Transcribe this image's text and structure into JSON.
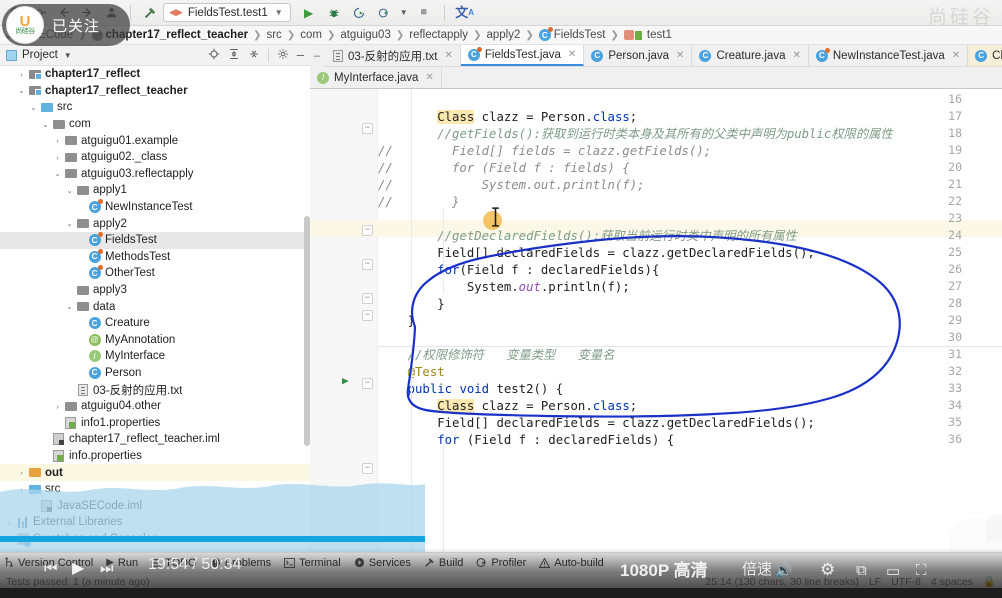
{
  "toolbar": {
    "back_icon": "arrow-left-icon",
    "forward_icon": "arrow-right-icon",
    "update_icon": "update-project-icon",
    "commit_icon": "commit-icon",
    "profile_icon": "user-icon",
    "build_icon": "hammer-icon",
    "run_config": "FieldsTest.test1",
    "run_label": "run-icon",
    "debug_label": "debug-icon",
    "coverage_label": "run-with-coverage-icon",
    "profile_label": "profiler-icon",
    "stop_label": "stop-icon",
    "translate_label": "translate-icon"
  },
  "breadcrumb": {
    "items": [
      {
        "label": "JavaSECode",
        "bold": false
      },
      {
        "label": "chapter17_reflect_teacher",
        "bold": true
      },
      {
        "label": "src",
        "bold": false
      },
      {
        "label": "com",
        "bold": false
      },
      {
        "label": "atguigu03",
        "bold": false
      },
      {
        "label": "reflectapply",
        "bold": false
      },
      {
        "label": "apply2",
        "bold": false
      },
      {
        "label": "FieldsTest",
        "bold": false
      },
      {
        "label": "test1",
        "bold": false
      }
    ]
  },
  "project_panel": {
    "title": "Project",
    "icons": [
      "locate-icon",
      "expand-all-icon",
      "collapse-all-icon",
      "settings-icon",
      "hide-icon"
    ],
    "tree": [
      {
        "label": "chapter17_reflect",
        "indent": 1,
        "arrow": "›",
        "icon": "module-folder",
        "bold": true
      },
      {
        "label": "chapter17_reflect_teacher",
        "indent": 1,
        "arrow": "⌄",
        "icon": "module-folder",
        "bold": true
      },
      {
        "label": "src",
        "indent": 2,
        "arrow": "⌄",
        "icon": "source-folder",
        "bold": false
      },
      {
        "label": "com",
        "indent": 3,
        "arrow": "⌄",
        "icon": "package-folder",
        "bold": false
      },
      {
        "label": "atguigu01.example",
        "indent": 4,
        "arrow": "›",
        "icon": "package-folder",
        "bold": false
      },
      {
        "label": "atguigu02._class",
        "indent": 4,
        "arrow": "›",
        "icon": "package-folder",
        "bold": false
      },
      {
        "label": "atguigu03.reflectapply",
        "indent": 4,
        "arrow": "⌄",
        "icon": "package-folder",
        "bold": false
      },
      {
        "label": "apply1",
        "indent": 5,
        "arrow": "⌄",
        "icon": "package-folder",
        "bold": false
      },
      {
        "label": "NewInstanceTest",
        "indent": 6,
        "arrow": "",
        "icon": "java-test-class",
        "bold": false
      },
      {
        "label": "apply2",
        "indent": 5,
        "arrow": "⌄",
        "icon": "package-folder",
        "bold": false
      },
      {
        "label": "FieldsTest",
        "indent": 6,
        "arrow": "",
        "icon": "java-test-class",
        "bold": false,
        "selected": true
      },
      {
        "label": "MethodsTest",
        "indent": 6,
        "arrow": "",
        "icon": "java-test-class",
        "bold": false
      },
      {
        "label": "OtherTest",
        "indent": 6,
        "arrow": "",
        "icon": "java-test-class",
        "bold": false
      },
      {
        "label": "apply3",
        "indent": 5,
        "arrow": "",
        "icon": "package-folder",
        "bold": false
      },
      {
        "label": "data",
        "indent": 5,
        "arrow": "⌄",
        "icon": "package-folder",
        "bold": false
      },
      {
        "label": "Creature",
        "indent": 6,
        "arrow": "",
        "icon": "java-class",
        "bold": false
      },
      {
        "label": "MyAnnotation",
        "indent": 6,
        "arrow": "",
        "icon": "annotation",
        "bold": false
      },
      {
        "label": "MyInterface",
        "indent": 6,
        "arrow": "",
        "icon": "interface",
        "bold": false
      },
      {
        "label": "Person",
        "indent": 6,
        "arrow": "",
        "icon": "java-class",
        "bold": false
      },
      {
        "label": "03-反射的应用.txt",
        "indent": 5,
        "arrow": "",
        "icon": "text-file",
        "bold": false
      },
      {
        "label": "atguigu04.other",
        "indent": 4,
        "arrow": "›",
        "icon": "package-folder",
        "bold": false
      },
      {
        "label": "info1.properties",
        "indent": 4,
        "arrow": "",
        "icon": "properties-file",
        "bold": false
      },
      {
        "label": "chapter17_reflect_teacher.iml",
        "indent": 3,
        "arrow": "",
        "icon": "iml-file",
        "bold": false
      },
      {
        "label": "info.properties",
        "indent": 3,
        "arrow": "",
        "icon": "properties-file",
        "bold": false
      },
      {
        "label": "out",
        "indent": 1,
        "arrow": "›",
        "icon": "output-folder",
        "bold": true,
        "highlight": true
      },
      {
        "label": "src",
        "indent": 1,
        "arrow": "›",
        "icon": "source-folder",
        "bold": false
      },
      {
        "label": "JavaSECode.iml",
        "indent": 2,
        "arrow": "",
        "icon": "iml-file",
        "bold": false
      },
      {
        "label": "External Libraries",
        "indent": 0,
        "arrow": "›",
        "icon": "external-libraries",
        "bold": false
      },
      {
        "label": "Scratches and Consoles",
        "indent": 0,
        "arrow": "›",
        "icon": "scratches",
        "bold": false
      }
    ]
  },
  "editor": {
    "tabs_row1": [
      {
        "label": "03-反射的应用.txt",
        "icon": "text-file",
        "active": false
      },
      {
        "label": "FieldsTest.java",
        "icon": "java-test-class",
        "active": true
      },
      {
        "label": "Person.java",
        "icon": "java-class",
        "active": false
      },
      {
        "label": "Creature.java",
        "icon": "java-class",
        "active": false
      },
      {
        "label": "NewInstanceTest.java",
        "icon": "java-test-class",
        "active": false
      },
      {
        "label": "Class.java",
        "icon": "java-class",
        "active": false,
        "readonly": true
      }
    ],
    "tabs_row2": [
      {
        "label": "MyInterface.java",
        "icon": "interface",
        "active": false
      }
    ],
    "line_numbers": [
      16,
      17,
      18,
      19,
      20,
      21,
      22,
      23,
      24,
      25,
      26,
      27,
      28,
      29,
      30,
      31,
      32,
      33,
      34,
      35,
      36
    ],
    "code_lines": [
      {
        "n": 16,
        "text": ""
      },
      {
        "n": 17,
        "text": "        Class clazz = Person.class;"
      },
      {
        "n": 18,
        "text": "        //getFields():获取到运行时类本身及其所有的父类中声明为public权限的属性"
      },
      {
        "n": 19,
        "text": "//        Field[] fields = clazz.getFields();"
      },
      {
        "n": 20,
        "text": "//        for (Field f : fields) {"
      },
      {
        "n": 21,
        "text": "//            System.out.println(f);"
      },
      {
        "n": 22,
        "text": "//        }"
      },
      {
        "n": 23,
        "text": ""
      },
      {
        "n": 24,
        "text": "        //getDeclaredFields():获取当前运行时类中声明的所有属性"
      },
      {
        "n": 25,
        "text": "        Field[] declaredFields = clazz.getDeclaredFields();"
      },
      {
        "n": 26,
        "text": "        for(Field f : declaredFields){"
      },
      {
        "n": 27,
        "text": "            System.out.println(f);"
      },
      {
        "n": 28,
        "text": "        }"
      },
      {
        "n": 29,
        "text": "    }"
      },
      {
        "n": 30,
        "text": ""
      },
      {
        "n": 31,
        "text": "    //权限修饰符   变量类型   变量名"
      },
      {
        "n": 32,
        "text": "    @Test"
      },
      {
        "n": 33,
        "text": "    public void test2() {"
      },
      {
        "n": 34,
        "text": "        Class clazz = Person.class;"
      },
      {
        "n": 35,
        "text": "        Field[] declaredFields = clazz.getDeclaredFields();"
      },
      {
        "n": 36,
        "text": "        for (Field f : declaredFields) {"
      }
    ],
    "run_gutter_line": 33,
    "annotation_color": "#1a31c8"
  },
  "bottom_tool_window": {
    "items": [
      {
        "label": "Version Control",
        "icon": "branch-icon"
      },
      {
        "label": "Run",
        "icon": "run-icon"
      },
      {
        "label": "TODO",
        "icon": "todo-icon"
      },
      {
        "label": "Problems",
        "icon": "problems-icon"
      },
      {
        "label": "Terminal",
        "icon": "terminal-icon"
      },
      {
        "label": "Services",
        "icon": "services-icon"
      },
      {
        "label": "Build",
        "icon": "hammer-icon"
      },
      {
        "label": "Profiler",
        "icon": "profiler-icon"
      },
      {
        "label": "Auto-build",
        "icon": "warning-icon"
      }
    ]
  },
  "status_bar": {
    "left": "Tests passed: 1 (a minute ago)",
    "right_position": "25:14 (130 chars, 30 line breaks)",
    "right_encoding": "UTF-8",
    "right_indent": "4 spaces",
    "right_lock": "lock-icon"
  },
  "video_overlay": {
    "current_time": "19:54",
    "separator": "/",
    "total_time": "50:34",
    "quality": "1080P 高清",
    "speed": "倍速",
    "prev_icon": "previous-icon",
    "play_icon": "play-icon",
    "next_icon": "next-icon",
    "volume_icon": "volume-icon",
    "settings_icon": "gear-icon",
    "pip_icon": "picture-in-picture-icon",
    "widescreen_icon": "widescreen-icon",
    "fullscreen_icon": "fullscreen-icon"
  },
  "overlays": {
    "follow_badge": "已关注",
    "logo_letter": "U",
    "logo_text": "尚硅谷",
    "watermark": "尚硅谷"
  }
}
